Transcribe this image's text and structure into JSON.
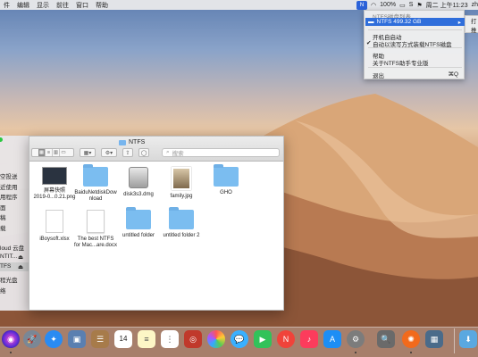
{
  "menubar": {
    "items": [
      "件",
      "编辑",
      "显示",
      "前往",
      "窗口",
      "帮助"
    ],
    "battery": "100%",
    "datetime": "周二 上午11:23",
    "user": "zh",
    "ntfs_icon_label": "N"
  },
  "ntfs_menu": {
    "header": "NTFS磁盘列表",
    "selected_disk": "NTFS  499.32 GB",
    "selected_arrow": "▸",
    "launch_at_login": "开机自启动",
    "auto_mount": "自动以读写方式装载NTFS磁盘",
    "auto_mount_check": "✔",
    "help": "帮助",
    "about": "关于NTFS助手专业版",
    "quit": "退出",
    "quit_shortcut": "⌘Q",
    "submenu": [
      "打",
      "推"
    ]
  },
  "sidebar": {
    "items": [
      "空投送",
      "近使用",
      "用程序",
      "面",
      "稿",
      "载",
      "loud 云盘",
      "NTIT...",
      "TFS",
      "程光盘",
      "络"
    ]
  },
  "finder": {
    "title": "NTFS",
    "search_placeholder": "搜索",
    "toolbar": {
      "back": "‹",
      "forward": "›",
      "share": "⇪",
      "tags": "◯"
    },
    "files": [
      {
        "name": "屏幕快照\n2019-0...0.21.png",
        "kind": "screenshot"
      },
      {
        "name": "BaiduNetdiskDow\nnload",
        "kind": "folder"
      },
      {
        "name": "disk3s3.dmg",
        "kind": "dmg"
      },
      {
        "name": "family.jpg",
        "kind": "photo"
      },
      {
        "name": "GHO",
        "kind": "folder"
      },
      {
        "name": "iBoysoft.xlsx",
        "kind": "xlsx"
      },
      {
        "name": "The best NTFS\nfor Mac...are.docx",
        "kind": "doc"
      },
      {
        "name": "untitled folder",
        "kind": "folder"
      },
      {
        "name": "untitled folder 2",
        "kind": "folder"
      }
    ]
  },
  "dock": {
    "calendar_day": "14",
    "apps": [
      "siri",
      "launchpad",
      "safari",
      "photos-preview",
      "contacts",
      "notes-brown",
      "calendar",
      "notes",
      "reminders",
      "photo-booth",
      "photos",
      "messages",
      "facetime",
      "news",
      "music",
      "app-store",
      "system-preferences",
      "preview",
      "ntfs-assistant",
      "image-capture",
      "downloads"
    ]
  }
}
